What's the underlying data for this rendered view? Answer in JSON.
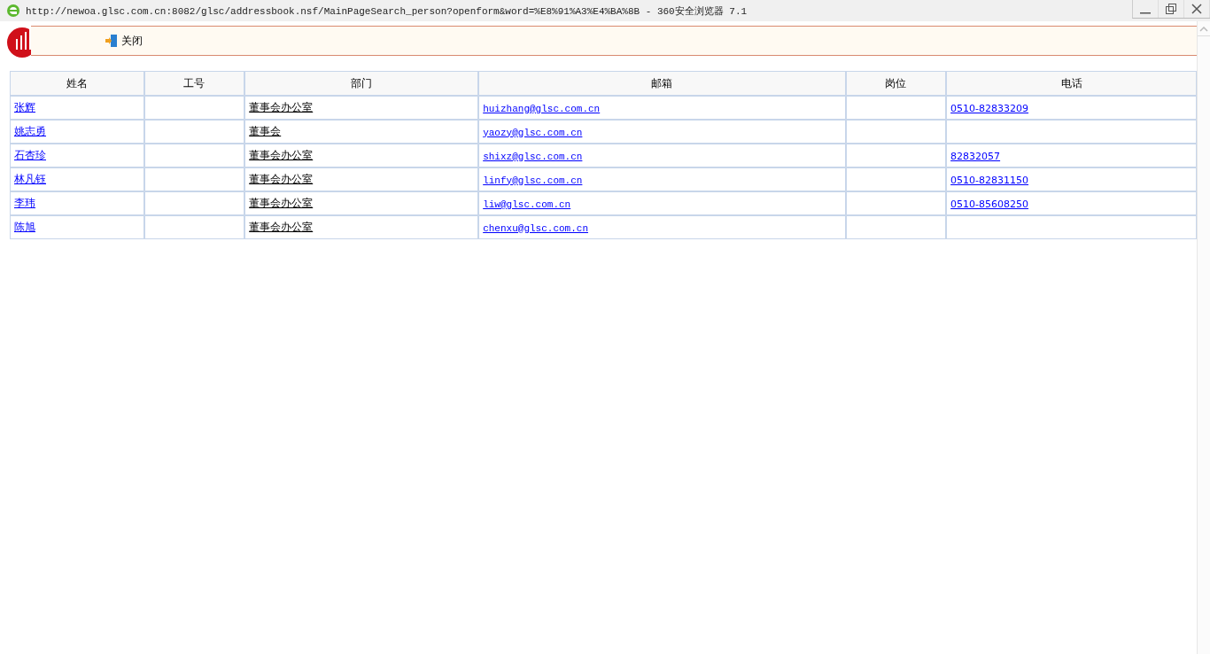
{
  "window": {
    "title": "http://newoa.glsc.com.cn:8082/glsc/addressbook.nsf/MainPageSearch_person?openform&word=%E8%91%A3%E4%BA%8B - 360安全浏览器 7.1"
  },
  "toolbar": {
    "close_label": "关闭"
  },
  "table": {
    "columns": [
      "姓名",
      "工号",
      "部门",
      "邮箱",
      "岗位",
      "电话"
    ],
    "rows": [
      {
        "name": "张辉",
        "department": "董事会办公室",
        "email": "huizhang@glsc.com.cn",
        "phone": "0510-82833209"
      },
      {
        "name": "姚志勇",
        "department": "董事会",
        "email": "yaozy@glsc.com.cn"
      },
      {
        "name": "石杏珍",
        "department": "董事会办公室",
        "email": "shixz@glsc.com.cn",
        "phone": "82832057"
      },
      {
        "name": "林凡钰",
        "department": "董事会办公室",
        "email": "linfy@glsc.com.cn",
        "phone": "0510-82831150"
      },
      {
        "name": "李玮",
        "department": "董事会办公室",
        "email": "liw@glsc.com.cn",
        "phone": "0510-85608250"
      },
      {
        "name": "陈旭",
        "department": "董事会办公室",
        "email": "chenxu@glsc.com.cn"
      }
    ]
  }
}
